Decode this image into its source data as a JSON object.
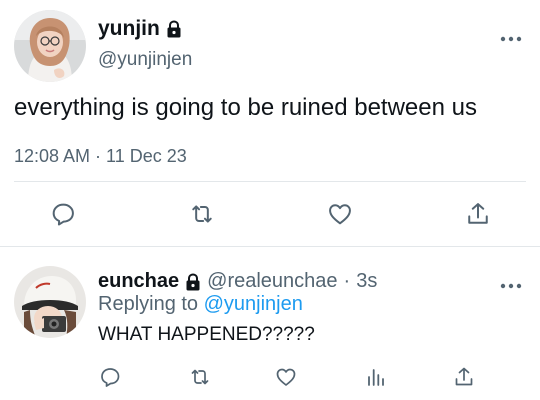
{
  "main_tweet": {
    "display_name": "yunjin",
    "handle": "@yunjinjen",
    "text": "everything is going to be ruined between us",
    "timestamp": "12:08 AM · 11 Dec 23",
    "avatar": "profile-photo",
    "badge_icon": "lock-icon",
    "menu_icon": "more-horizontal-icon",
    "actions": [
      "reply-icon",
      "retweet-icon",
      "like-icon",
      "share-icon"
    ]
  },
  "reply": {
    "display_name": "eunchae",
    "handle": "@realeunchae",
    "separator": "·",
    "time_ago": "3s",
    "replying_prefix": "Replying to",
    "replying_to": "@yunjinjen",
    "text": "WHAT HAPPENED?????",
    "avatar": "profile-photo",
    "badge_icon": "lock-icon",
    "menu_icon": "more-horizontal-icon",
    "actions": [
      "reply-icon",
      "retweet-icon",
      "like-icon",
      "views-icon",
      "share-icon"
    ]
  },
  "colors": {
    "text_primary": "#0f1419",
    "text_secondary": "#536471",
    "mention": "#1d9bf0",
    "divider": "#e3e7ea"
  }
}
